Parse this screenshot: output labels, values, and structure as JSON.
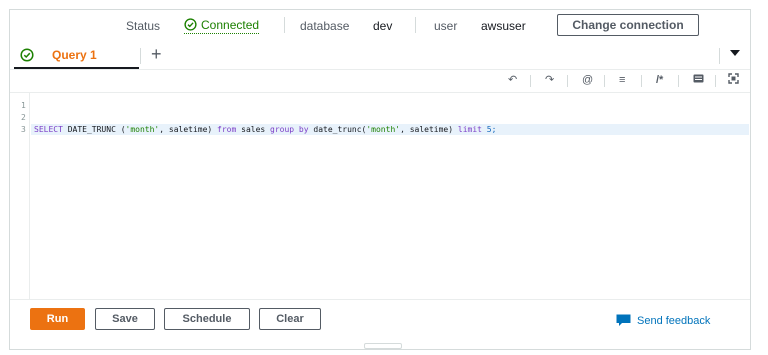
{
  "status_bar": {
    "status_label": "Status",
    "status_value": "Connected",
    "database_label": "database",
    "database_value": "dev",
    "user_label": "user",
    "user_value": "awsuser",
    "change_connection_label": "Change connection"
  },
  "tabs": [
    {
      "label": "Query 1",
      "icon": "check-circle-icon",
      "active": true
    }
  ],
  "toolbar": {
    "icons": [
      "undo-icon",
      "redo-icon",
      "find-icon",
      "format-icon",
      "comment-icon",
      "keyboard-icon",
      "fullscreen-icon"
    ]
  },
  "editor": {
    "line_numbers": [
      "1",
      "2",
      "3"
    ],
    "code_tokens": [
      {
        "t": "SELECT ",
        "c": "kw"
      },
      {
        "t": "DATE_TRUNC ",
        "c": "pl"
      },
      {
        "t": "(",
        "c": "pl"
      },
      {
        "t": "'month'",
        "c": "str"
      },
      {
        "t": ", saletime) ",
        "c": "pl"
      },
      {
        "t": "from",
        "c": "kw"
      },
      {
        "t": " sales ",
        "c": "pl"
      },
      {
        "t": "group by",
        "c": "kw"
      },
      {
        "t": " date_trunc(",
        "c": "pl"
      },
      {
        "t": "'month'",
        "c": "str"
      },
      {
        "t": ", saletime) ",
        "c": "pl"
      },
      {
        "t": "limit",
        "c": "kw"
      },
      {
        "t": " 5;",
        "c": "num"
      }
    ]
  },
  "actions": {
    "run_label": "Run",
    "save_label": "Save",
    "schedule_label": "Schedule",
    "clear_label": "Clear",
    "feedback_label": "Send feedback"
  },
  "colors": {
    "accent": "#ec7211",
    "connected": "#1d8102",
    "link": "#0073bb"
  }
}
